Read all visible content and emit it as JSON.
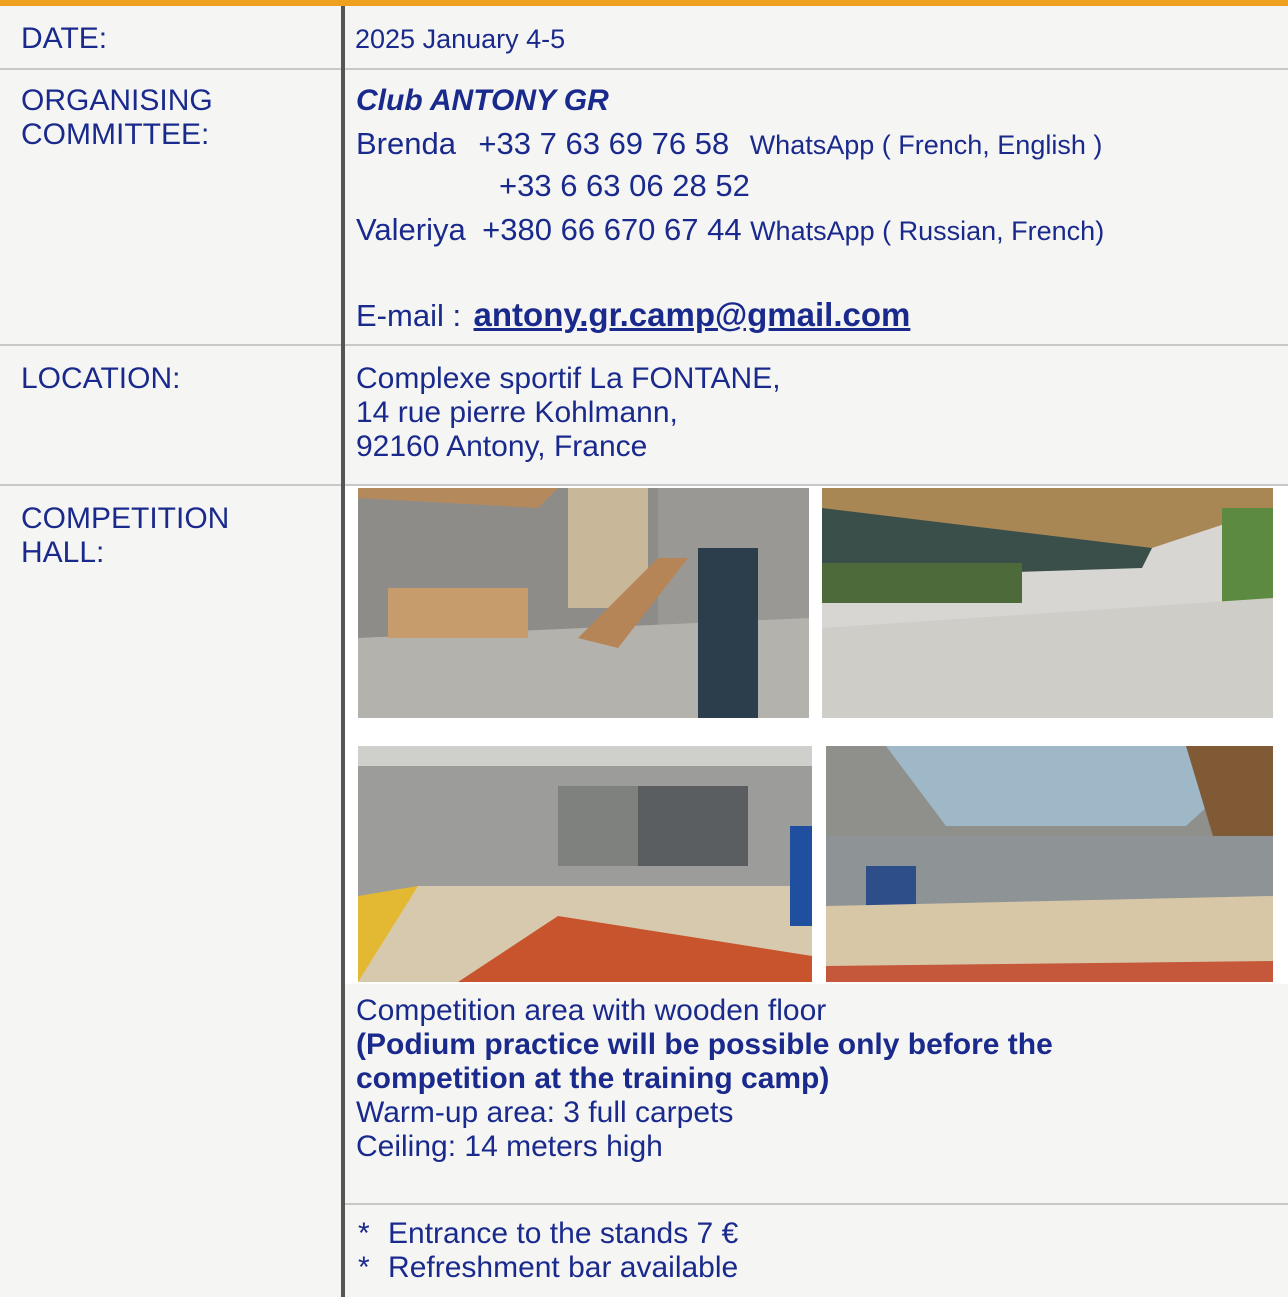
{
  "rows": {
    "date": {
      "label": "DATE:",
      "value": "2025 January 4-5"
    },
    "committee": {
      "label_line1": "ORGANISING",
      "label_line2": "COMMITTEE:",
      "club": "Club ANTONY GR",
      "contact1_name": "Brenda",
      "contact1_phone": "+33 7 63 69 76 58",
      "contact1_note": "WhatsApp ( French, English )",
      "contact1_phone2": "+33 6 63 06 28 52",
      "contact2_name": "Valeriya",
      "contact2_phone": "+380 66 670 67 44",
      "contact2_note": "WhatsApp ( Russian, French)",
      "email_label": "E-mail :",
      "email": "antony.gr.camp@gmail.com"
    },
    "location": {
      "label": "LOCATION:",
      "line1": "Complexe sportif La FONTANE,",
      "line2": "14 rue pierre Kohlmann,",
      "line3": "92160 Antony, France"
    },
    "hall": {
      "label_line1": "COMPETITION",
      "label_line2": "HALL:",
      "desc_line1": "Competition area with wooden floor",
      "desc_bold1": "(Podium practice will be possible only before the",
      "desc_bold2": "competition at the training camp)",
      "desc_line4": "Warm-up area: 3 full carpets",
      "desc_line5": "Ceiling: 14 meters high",
      "note1": "Entrance to the stands 7 €",
      "note2": "Refreshment bar available",
      "bullet": "*"
    }
  },
  "colors": {
    "text": "#1a2a8c",
    "accent_bar": "#f0a020",
    "cell_bg": "#f5f5f4",
    "divider": "#555555"
  }
}
